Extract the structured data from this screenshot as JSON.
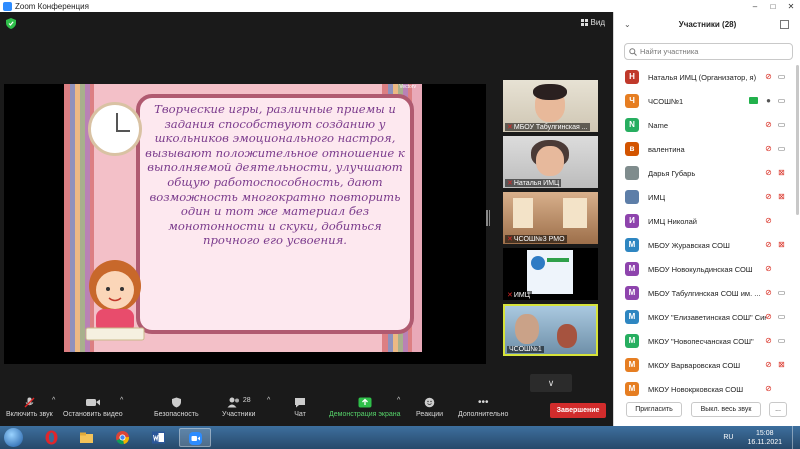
{
  "window": {
    "title": "Zoom Конференция"
  },
  "meeting": {
    "view_label": "Вид",
    "slide_text": "Творческие игры, различные приемы и задания способствуют созданию у школьников эмоционального настроя, вызывают положительное отношение к выполняемой деятельности, улучшают общую работоспособность, дают возможность многократно повторить один и тот же материал без монотонности и скуки, добиться прочного его усвоения.",
    "slide_corner_text": "Vectorv",
    "thumbnails": [
      {
        "name": "МБОУ Табулгинская ..."
      },
      {
        "name": "Наталья ИМЦ"
      },
      {
        "name": "ЧСОШ№3 РМО"
      },
      {
        "name": "ИМЦ"
      },
      {
        "name": "ЧСОШ№1"
      }
    ]
  },
  "toolbar": {
    "audio_label": "Включить звук",
    "video_label": "Остановить видео",
    "security_label": "Безопасность",
    "participants_label": "Участники",
    "participants_count": "28",
    "chat_label": "Чат",
    "share_label": "Демонстрация экрана",
    "reactions_label": "Реакции",
    "more_label": "Дополнительно",
    "end_label": "Завершение"
  },
  "panel": {
    "title": "Участники (28)",
    "search_placeholder": "Найти участника",
    "participants": [
      {
        "initial": "Н",
        "name": "Наталья ИМЦ (Организатор, я)",
        "color": "#c0392b",
        "sharing": false,
        "mic": "off",
        "cam": "on"
      },
      {
        "initial": "Ч",
        "name": "ЧСОШ№1",
        "color": "#e67e22",
        "sharing": true,
        "mic": "on",
        "cam": "on"
      },
      {
        "initial": "N",
        "name": "Name",
        "color": "#27ae60",
        "sharing": false,
        "mic": "off",
        "cam": "on"
      },
      {
        "initial": "в",
        "name": "валентина",
        "color": "#d35400",
        "sharing": false,
        "mic": "off",
        "cam": "on"
      },
      {
        "initial": "",
        "name": "Дарья Губарь",
        "color": "#7f8c8d",
        "sharing": false,
        "mic": "off",
        "cam": "off"
      },
      {
        "initial": "",
        "name": "ИМЦ",
        "color": "#5d7ea8",
        "sharing": false,
        "mic": "off",
        "cam": "off"
      },
      {
        "initial": "И",
        "name": "ИМЦ Николай",
        "color": "#8e44ad",
        "sharing": false,
        "mic": "off",
        "cam": "none"
      },
      {
        "initial": "М",
        "name": "МБОУ Журавская СОШ",
        "color": "#2e86c1",
        "sharing": false,
        "mic": "off",
        "cam": "off"
      },
      {
        "initial": "М",
        "name": "МБОУ Новокульдинская СОШ",
        "color": "#8e44ad",
        "sharing": false,
        "mic": "off",
        "cam": "none"
      },
      {
        "initial": "М",
        "name": "МБОУ Табулгинская СОШ им. ...",
        "color": "#8e44ad",
        "sharing": false,
        "mic": "off",
        "cam": "on"
      },
      {
        "initial": "М",
        "name": "МКОУ \"Елизаветинская СОШ\" Син...",
        "color": "#2e86c1",
        "sharing": false,
        "mic": "off",
        "cam": "on"
      },
      {
        "initial": "М",
        "name": "МКОУ \"Новопесчанская СОШ\"",
        "color": "#27ae60",
        "sharing": false,
        "mic": "off",
        "cam": "on"
      },
      {
        "initial": "М",
        "name": "МКОУ Варваровская СОШ",
        "color": "#e67e22",
        "sharing": false,
        "mic": "off",
        "cam": "off"
      },
      {
        "initial": "М",
        "name": "МКОУ Новокрковская СОШ",
        "color": "#e67e22",
        "sharing": false,
        "mic": "off",
        "cam": "none"
      }
    ],
    "invite_label": "Пригласить",
    "mute_all_label": "Выкл. весь звук",
    "more_label": "..."
  },
  "taskbar": {
    "language": "RU",
    "time": "15:08",
    "date": "16.11.2021"
  }
}
